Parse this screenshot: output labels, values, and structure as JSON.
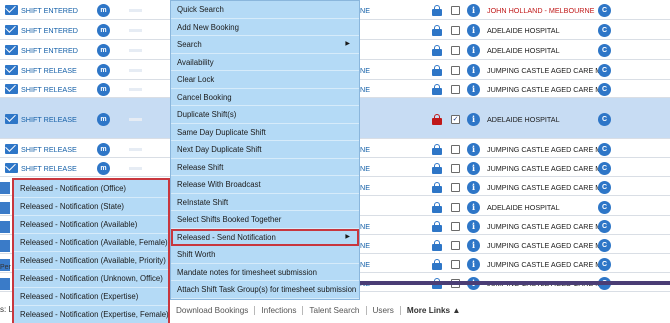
{
  "grid": {
    "rows": [
      {
        "status": "SHIFT ENTERED",
        "ne": "NE",
        "location": "JOHN HOLLAND - MELBOURNE",
        "location_red": true,
        "locked": "blue",
        "checked": false
      },
      {
        "status": "SHIFT ENTERED",
        "ne": "",
        "location": "ADELAIDE HOSPITAL",
        "location_red": false,
        "locked": "blue",
        "checked": false
      },
      {
        "status": "SHIFT ENTERED",
        "ne": "",
        "location": "ADELAIDE HOSPITAL",
        "location_red": false,
        "locked": "blue",
        "checked": false
      },
      {
        "status": "SHIFT RELEASE",
        "ne": "NE",
        "location": "JUMPING CASTLE AGED CARE M...",
        "location_red": false,
        "locked": "blue",
        "checked": false
      },
      {
        "status": "SHIFT RELEASE",
        "ne": "NE",
        "location": "JUMPING CASTLE AGED CARE M...",
        "location_red": false,
        "locked": "blue",
        "checked": false
      },
      {
        "status": "SHIFT RELEASE",
        "ne": "",
        "location": "ADELAIDE HOSPITAL",
        "location_red": false,
        "locked": "red",
        "checked": true
      },
      {
        "status": "SHIFT RELEASE",
        "ne": "NE",
        "location": "JUMPING CASTLE AGED CARE M...",
        "location_red": false,
        "locked": "blue",
        "checked": false
      },
      {
        "status": "SHIFT RELEASE",
        "ne": "NE",
        "location": "JUMPING CASTLE AGED CARE M...",
        "location_red": false,
        "locked": "blue",
        "checked": false
      },
      {
        "status": "",
        "ne": "NE",
        "location": "JUMPING CASTLE AGED CARE M...",
        "location_red": false,
        "locked": "blue",
        "checked": false
      },
      {
        "status": "",
        "ne": "",
        "location": "ADELAIDE HOSPITAL",
        "location_red": false,
        "locked": "blue",
        "checked": false
      },
      {
        "status": "",
        "ne": "NE",
        "location": "JUMPING CASTLE AGED CARE M...",
        "location_red": false,
        "locked": "blue",
        "checked": false
      },
      {
        "status": "",
        "ne": "NE",
        "location": "JUMPING CASTLE AGED CARE M...",
        "location_red": false,
        "locked": "blue",
        "checked": false
      },
      {
        "status": "",
        "ne": "NE",
        "location": "JUMPING CASTLE AGED CARE M...",
        "location_red": false,
        "locked": "blue",
        "checked": false
      },
      {
        "status": "",
        "ne": "NE",
        "location": "JUMPING CASTLE AGED CARE M...",
        "location_red": false,
        "locked": "blue",
        "checked": false
      }
    ],
    "m_icon": "m",
    "info_icon": "i",
    "c_icon": "C",
    "check_mark": "✓"
  },
  "context_menu": {
    "items": [
      {
        "label": "Quick Search",
        "submenu": false
      },
      {
        "label": "Add New Booking",
        "submenu": false
      },
      {
        "label": "Search",
        "submenu": true
      },
      {
        "label": "Availability",
        "submenu": false
      },
      {
        "label": "Clear Lock",
        "submenu": false
      },
      {
        "label": "Cancel Booking",
        "submenu": false
      },
      {
        "label": "Duplicate Shift(s)",
        "submenu": false
      },
      {
        "label": "Same Day Duplicate Shift",
        "submenu": false
      },
      {
        "label": "Next Day Duplicate Shift",
        "submenu": false
      },
      {
        "label": "Release Shift",
        "submenu": false
      },
      {
        "label": "Release With Broadcast",
        "submenu": false
      },
      {
        "label": "ReInstate Shift",
        "submenu": false
      },
      {
        "label": "Select Shifts Booked Together",
        "submenu": false
      },
      {
        "label": "Released - Send Notification",
        "submenu": true,
        "highlighted": true
      },
      {
        "label": "Shift Worth",
        "submenu": false
      },
      {
        "label": "Mandate notes for timesheet submission",
        "submenu": false
      },
      {
        "label": "Attach Shift Task Group(s) for timesheet submission",
        "submenu": false
      }
    ],
    "arrow_glyph": "▶"
  },
  "submenu": {
    "items": [
      "Released - Notification (Office)",
      "Released - Notification (State)",
      "Released - Notification (Available)",
      "Released - Notification (Available, Female)",
      "Released - Notification (Available, Priority)",
      "Released - Notification (Unknown, Office)",
      "Released - Notification (Expertise)",
      "Released - Notification (Expertise, Female)"
    ]
  },
  "left_fragments": {
    "per": "Per",
    "lc": "s: Lc"
  },
  "bottom_bar": {
    "links": [
      "Download Bookings",
      "Infections",
      "Talent Search",
      "Users"
    ],
    "more_links": "More Links ▲"
  },
  "colors": {
    "accent_blue": "#2e76c7",
    "menu_bg": "#b4daf6",
    "highlight_red": "#c8373e",
    "selected_row": "#c7dcf3",
    "status_text": "#1560a8",
    "lock_red": "#c01818"
  }
}
